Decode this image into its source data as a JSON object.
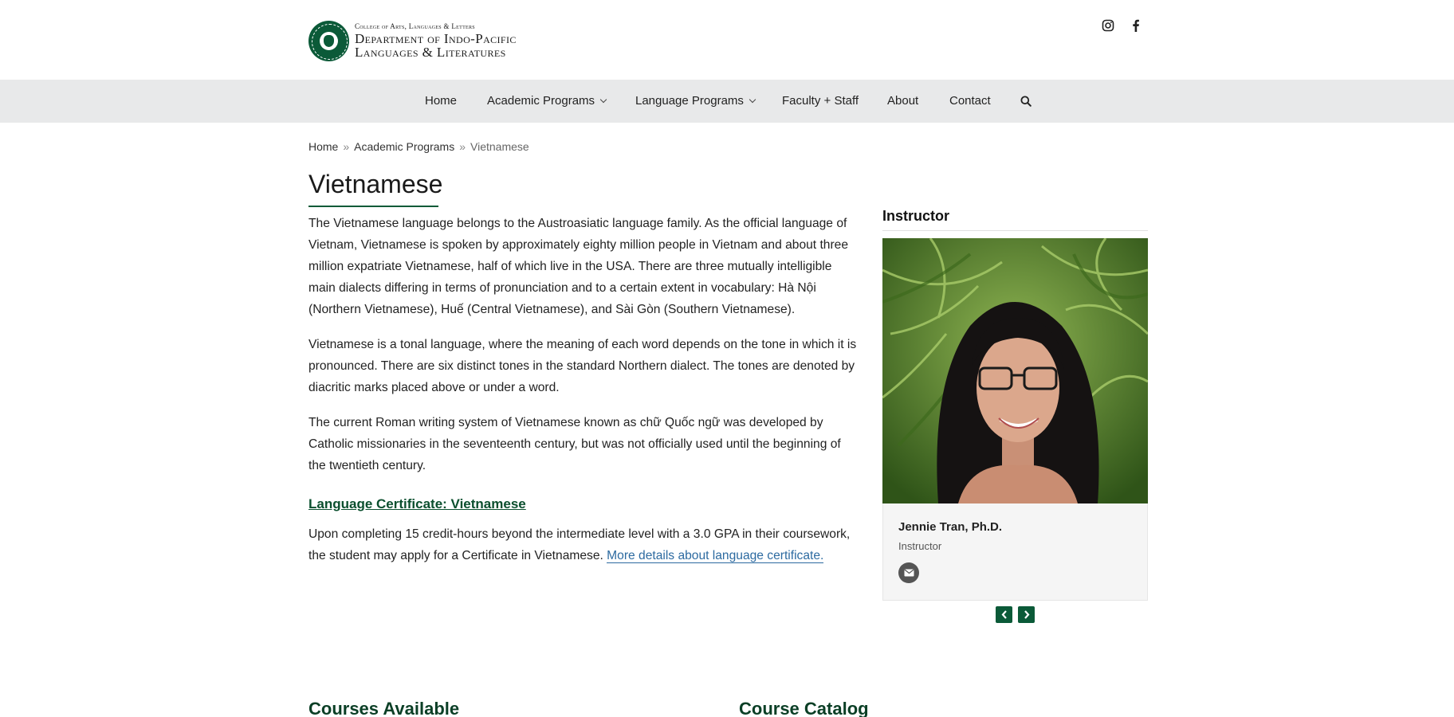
{
  "header": {
    "logo_sup": "College of Arts, Languages & Letters",
    "logo_line1": "Department of Indo-Pacific",
    "logo_line2": "Languages & Literatures"
  },
  "social": [
    {
      "icon": "instagram-icon"
    },
    {
      "icon": "facebook-icon"
    }
  ],
  "nav": {
    "items": [
      {
        "label": "Home"
      },
      {
        "label": "Academic Programs",
        "dropdown": true
      },
      {
        "label": "Language Programs",
        "dropdown": true
      },
      {
        "label": "Faculty + Staff"
      },
      {
        "label": "About"
      },
      {
        "label": "Contact"
      }
    ],
    "search_icon": "search-icon"
  },
  "breadcrumb": {
    "items": [
      "Home",
      "Academic Programs",
      "Vietnamese"
    ],
    "separator": "»"
  },
  "page": {
    "title": "Vietnamese",
    "paragraphs": [
      "The Vietnamese language belongs to the Austroasiatic language family. As the official language of Vietnam, Vietnamese is spoken by approximately eighty million people in Vietnam and about three million expatriate Vietnamese, half of which live in the USA. There are three mutually intelligible main dialects differing in terms of pronunciation and to a certain extent in vocabulary: Hà Nội (Northern Vietnamese), Huế (Central Vietnamese), and Sài Gòn (Southern Vietnamese).",
      "Vietnamese is a tonal language, where the meaning of each word depends on the tone in which it is pronounced. There are six distinct tones in the standard Northern dialect. The tones are denoted by diacritic marks placed above or under a word.",
      "The current Roman writing system of Vietnamese known as chữ Quốc ngữ was developed by Catholic missionaries in the seventeenth century, but was not officially used until the beginning of the twentieth century."
    ],
    "certificate_heading": "Language Certificate: Vietnamese",
    "certificate_text": "Upon completing 15 credit-hours beyond the intermediate level with a 3.0 GPA in their coursework, the student may apply for a Certificate in Vietnamese. ",
    "certificate_link": "More details about language certificate."
  },
  "sidebar": {
    "title": "Instructor",
    "person": {
      "name": "Jennie Tran, Ph.D.",
      "role": "Instructor",
      "email_icon": "envelope-icon"
    },
    "prev_icon": "chevron-left-icon",
    "next_icon": "chevron-right-icon"
  },
  "bottom": {
    "courses_heading": "Courses Available",
    "catalog_heading": "Course Catalog"
  },
  "colors": {
    "brand_green": "#0b5a38",
    "nav_bg": "#e8e9ea",
    "link_blue": "#2c6aa0"
  }
}
